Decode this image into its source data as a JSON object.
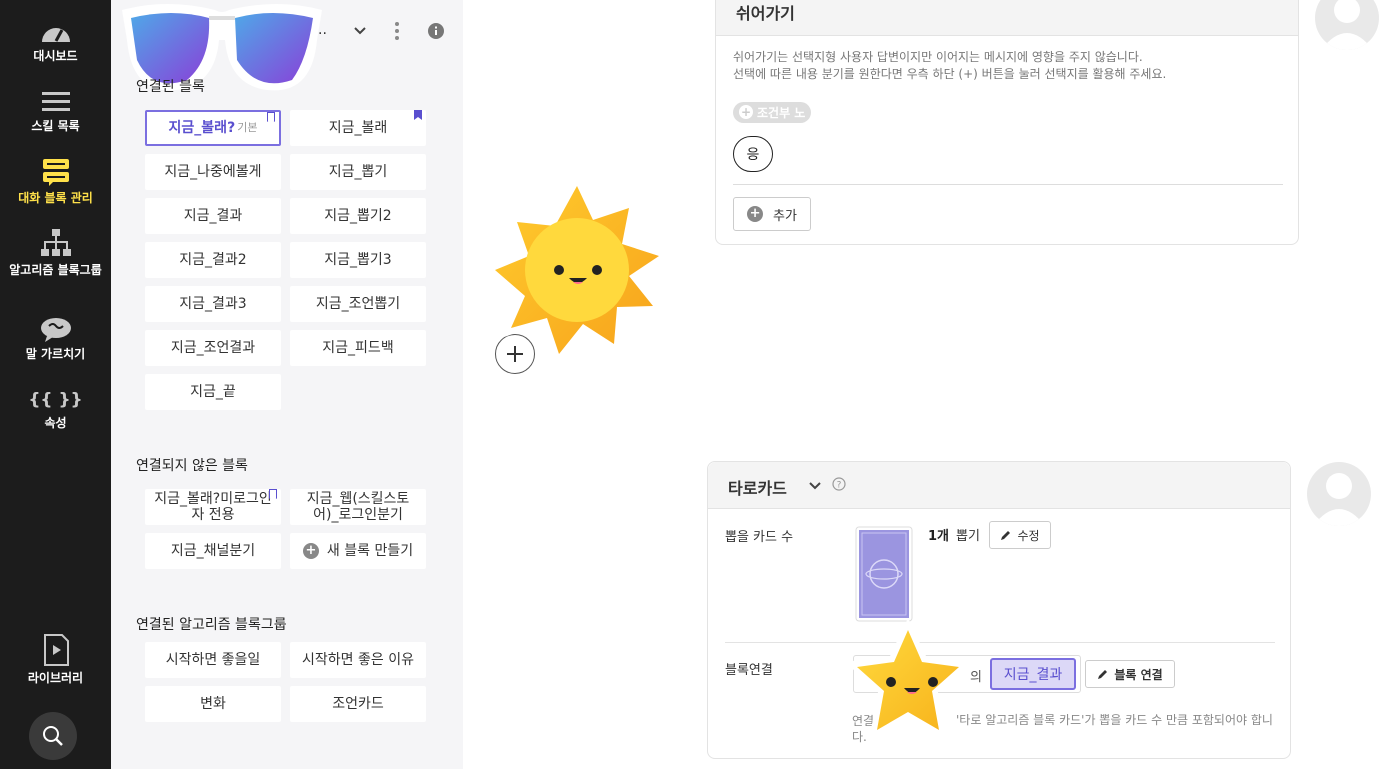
{
  "nav": {
    "items": [
      {
        "label": "대시보드",
        "icon": "gauge-icon"
      },
      {
        "label": "스킬 목록",
        "icon": "menu-icon"
      },
      {
        "label": "대화 블록 관리",
        "icon": "chat-blocks-icon",
        "active": true
      },
      {
        "label": "알고리즘 블록그룹",
        "icon": "hierarchy-icon"
      },
      {
        "label": "말 가르치기",
        "icon": "brain-icon"
      },
      {
        "label": "속성",
        "icon": "braces-icon"
      },
      {
        "label": "라이브러리",
        "icon": "library-icon"
      }
    ],
    "braces_glyph": "{{ }}",
    "search_icon": "search-icon"
  },
  "panel": {
    "header_ellipsis": "..",
    "connected_title": "연결된 블록",
    "connected_blocks": [
      {
        "label": "지금_볼래?",
        "sub": "기본",
        "selected": true,
        "flag": "outline"
      },
      {
        "label": "지금_볼래",
        "flag": "filled"
      },
      {
        "label": "지금_나중에볼게"
      },
      {
        "label": "지금_뽑기"
      },
      {
        "label": "지금_결과"
      },
      {
        "label": "지금_뽑기2"
      },
      {
        "label": "지금_결과2"
      },
      {
        "label": "지금_뽑기3"
      },
      {
        "label": "지금_결과3"
      },
      {
        "label": "지금_조언뽑기"
      },
      {
        "label": "지금_조언결과"
      },
      {
        "label": "지금_피드백"
      },
      {
        "label": "지금_끝"
      }
    ],
    "unconnected_title": "연결되지 않은 블록",
    "unconnected_blocks": [
      {
        "label": "지금_볼래?미로그인자 전용",
        "flag": "outline"
      },
      {
        "label": "지금_웹(스킬스토어)_로그인분기"
      },
      {
        "label": "지금_채널분기"
      },
      {
        "label": "새 블록 만들기",
        "is_new": true
      }
    ],
    "algo_title": "연결된 알고리즘 블록그룹",
    "algo_blocks": [
      {
        "label": "시작하면 좋을일"
      },
      {
        "label": "시작하면 좋은 이유"
      },
      {
        "label": "변화"
      },
      {
        "label": "조언카드"
      }
    ]
  },
  "skip_card": {
    "title": "쉬어가기",
    "desc_line1": "쉬어가기는 선택지형 사용자 답변이지만 이어지는 메시지에 영향을 주지 않습니다.",
    "desc_line2": "선택에 따른 내용 분기를 원한다면 우측 하단 (+) 버튼을 눌러 선택지를 활용해 주세요.",
    "condition_chip": "조건부 노",
    "option": "응",
    "add_label": "추가"
  },
  "tarot_card": {
    "title": "타로카드",
    "draw_count_label": "뽑을 카드 수",
    "draw_count_value": "1개",
    "draw_suffix": "뽑기",
    "edit_label": "수정",
    "block_link_label": "블록연결",
    "linked_block": "지금_결과",
    "link_button": "블록 연결",
    "hint_prefix": "연결",
    "hint_text": "'타로 알고리즘 블록 카드'가 뽑을 카드 수 만큼 포함되어야 합니다.",
    "connector_fragment": "의"
  },
  "colors": {
    "accent": "#5a4fcf",
    "nav_bg": "#1c1c1c",
    "nav_active": "#ffe14a",
    "panel_bg": "#f5f5f7"
  }
}
